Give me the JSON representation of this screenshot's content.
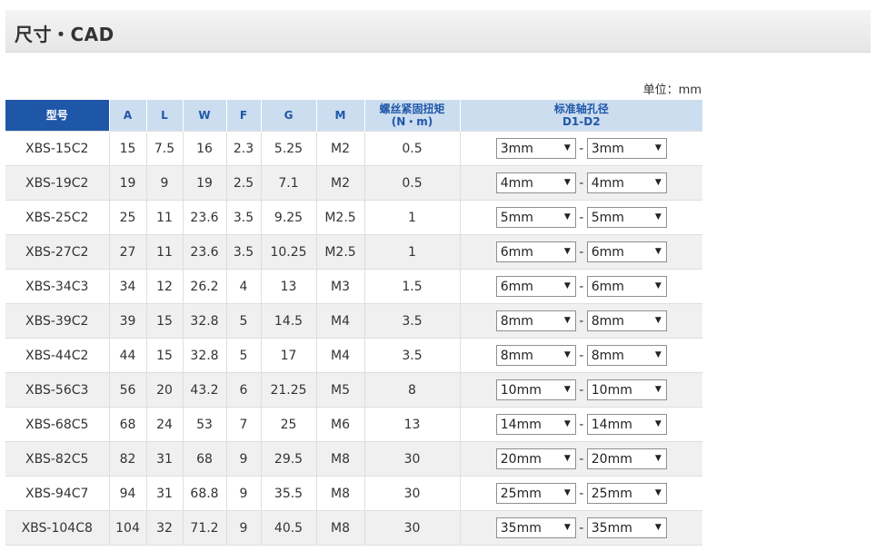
{
  "header": {
    "title": "尺寸・CAD"
  },
  "unit_label": "单位：mm",
  "table": {
    "columns": [
      "型号",
      "A",
      "L",
      "W",
      "F",
      "G",
      "M",
      "螺丝紧固扭矩",
      "(N・m)",
      "标准轴孔径",
      "D1-D2"
    ],
    "rows": [
      {
        "model": "XBS-15C2",
        "a": "15",
        "l": "7.5",
        "w": "16",
        "f": "2.3",
        "g": "5.25",
        "m": "M2",
        "torque": "0.5",
        "d1": "3mm",
        "d2": "3mm"
      },
      {
        "model": "XBS-19C2",
        "a": "19",
        "l": "9",
        "w": "19",
        "f": "2.5",
        "g": "7.1",
        "m": "M2",
        "torque": "0.5",
        "d1": "4mm",
        "d2": "4mm"
      },
      {
        "model": "XBS-25C2",
        "a": "25",
        "l": "11",
        "w": "23.6",
        "f": "3.5",
        "g": "9.25",
        "m": "M2.5",
        "torque": "1",
        "d1": "5mm",
        "d2": "5mm"
      },
      {
        "model": "XBS-27C2",
        "a": "27",
        "l": "11",
        "w": "23.6",
        "f": "3.5",
        "g": "10.25",
        "m": "M2.5",
        "torque": "1",
        "d1": "6mm",
        "d2": "6mm"
      },
      {
        "model": "XBS-34C3",
        "a": "34",
        "l": "12",
        "w": "26.2",
        "f": "4",
        "g": "13",
        "m": "M3",
        "torque": "1.5",
        "d1": "6mm",
        "d2": "6mm"
      },
      {
        "model": "XBS-39C2",
        "a": "39",
        "l": "15",
        "w": "32.8",
        "f": "5",
        "g": "14.5",
        "m": "M4",
        "torque": "3.5",
        "d1": "8mm",
        "d2": "8mm"
      },
      {
        "model": "XBS-44C2",
        "a": "44",
        "l": "15",
        "w": "32.8",
        "f": "5",
        "g": "17",
        "m": "M4",
        "torque": "3.5",
        "d1": "8mm",
        "d2": "8mm"
      },
      {
        "model": "XBS-56C3",
        "a": "56",
        "l": "20",
        "w": "43.2",
        "f": "6",
        "g": "21.25",
        "m": "M5",
        "torque": "8",
        "d1": "10mm",
        "d2": "10mm"
      },
      {
        "model": "XBS-68C5",
        "a": "68",
        "l": "24",
        "w": "53",
        "f": "7",
        "g": "25",
        "m": "M6",
        "torque": "13",
        "d1": "14mm",
        "d2": "14mm"
      },
      {
        "model": "XBS-82C5",
        "a": "82",
        "l": "31",
        "w": "68",
        "f": "9",
        "g": "29.5",
        "m": "M8",
        "torque": "30",
        "d1": "20mm",
        "d2": "20mm"
      },
      {
        "model": "XBS-94C7",
        "a": "94",
        "l": "31",
        "w": "68.8",
        "f": "9",
        "g": "35.5",
        "m": "M8",
        "torque": "30",
        "d1": "25mm",
        "d2": "25mm"
      },
      {
        "model": "XBS-104C8",
        "a": "104",
        "l": "32",
        "w": "71.2",
        "f": "9",
        "g": "40.5",
        "m": "M8",
        "torque": "30",
        "d1": "35mm",
        "d2": "35mm"
      }
    ],
    "dash": "-",
    "dropdown_arrow": "▼",
    "dropdown_icon": "chevron-down-icon"
  }
}
